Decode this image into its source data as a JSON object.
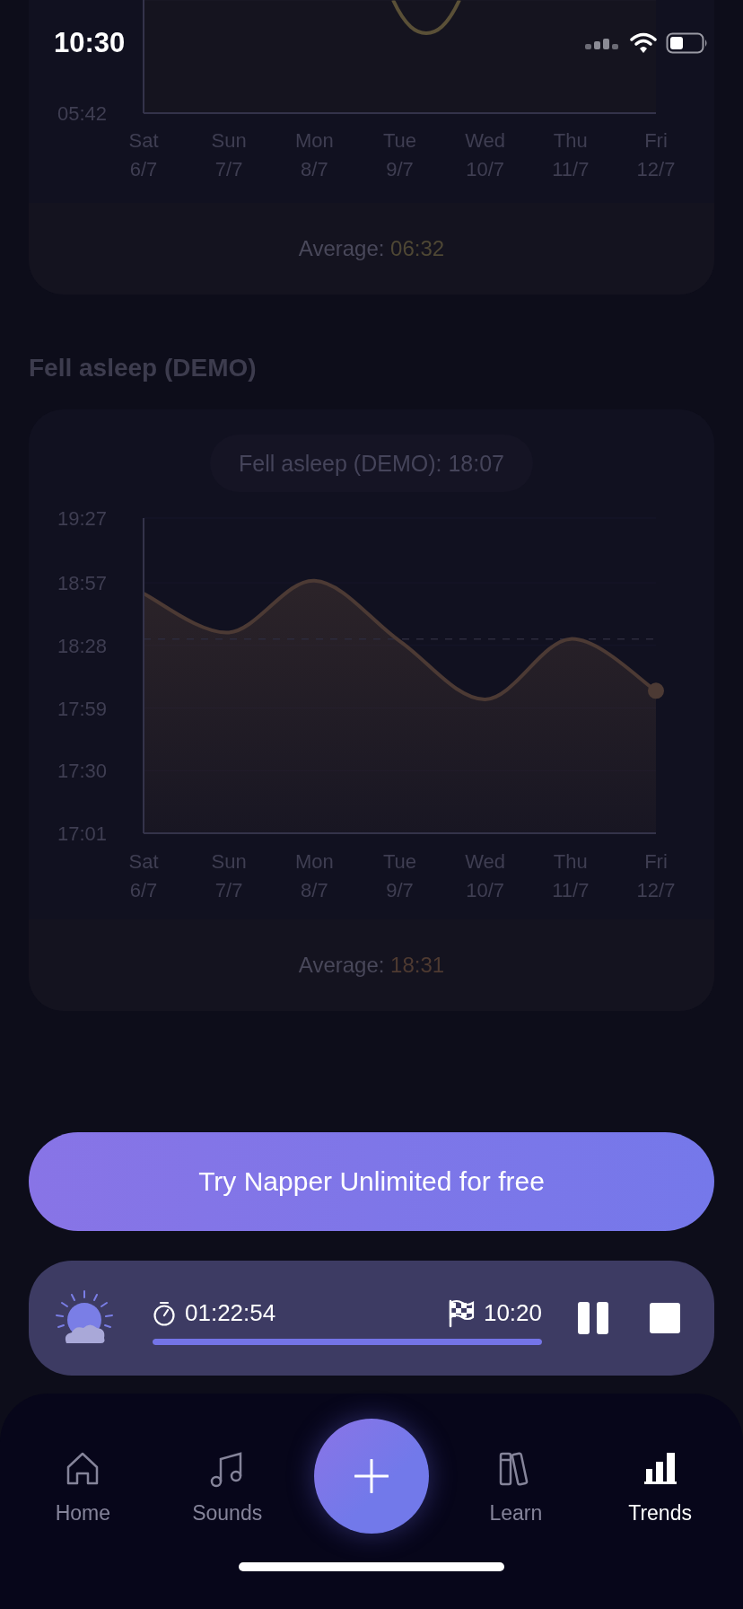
{
  "status_bar": {
    "time": "10:30"
  },
  "sleep_chart": {
    "ytick": "05:42",
    "days": [
      "Sat 6/7",
      "Sun 7/7",
      "Mon 8/7",
      "Tue 9/7",
      "Wed 10/7",
      "Thu 11/7",
      "Fri 12/7"
    ],
    "average": {
      "label": "Average:",
      "value": "06:32"
    }
  },
  "fell_asleep": {
    "title": "Fell asleep (DEMO)",
    "tooltip": "Fell asleep (DEMO): 18:07",
    "average": {
      "label": "Average:",
      "value": "18:31"
    },
    "chart_data": {
      "type": "area",
      "categories": [
        "Sat 6/7",
        "Sun 7/7",
        "Mon 8/7",
        "Tue 9/7",
        "Wed 10/7",
        "Thu 11/7",
        "Fri 12/7"
      ],
      "series": [
        {
          "color": "#4c3a34",
          "values": [
            1132,
            1114,
            1138,
            1110,
            1083,
            1111,
            1087
          ]
        }
      ],
      "ylim": [
        1021,
        1167
      ],
      "yticks": [
        {
          "value": 1167,
          "label": "19:27"
        },
        {
          "value": 1137,
          "label": "18:57"
        },
        {
          "value": 1108,
          "label": "18:28"
        },
        {
          "value": 1079,
          "label": "17:59"
        },
        {
          "value": 1050,
          "label": "17:30"
        },
        {
          "value": 1021,
          "label": "17:01"
        }
      ],
      "grid": true,
      "ref_lines": [
        {
          "axis": "y",
          "value": 1111
        }
      ]
    }
  },
  "upgrade_button": {
    "label": "Try Napper Unlimited for free"
  },
  "player": {
    "elapsed": "01:22:54",
    "alarm": "10:20",
    "level": 1,
    "playing": true
  },
  "nav": [
    {
      "label": "Home",
      "kind": "home",
      "selected": false
    },
    {
      "label": "Sounds",
      "kind": "music",
      "selected": false
    },
    {
      "label": "Learn",
      "kind": "books",
      "selected": false
    },
    {
      "label": "Trends",
      "kind": "bars",
      "selected": true
    }
  ]
}
